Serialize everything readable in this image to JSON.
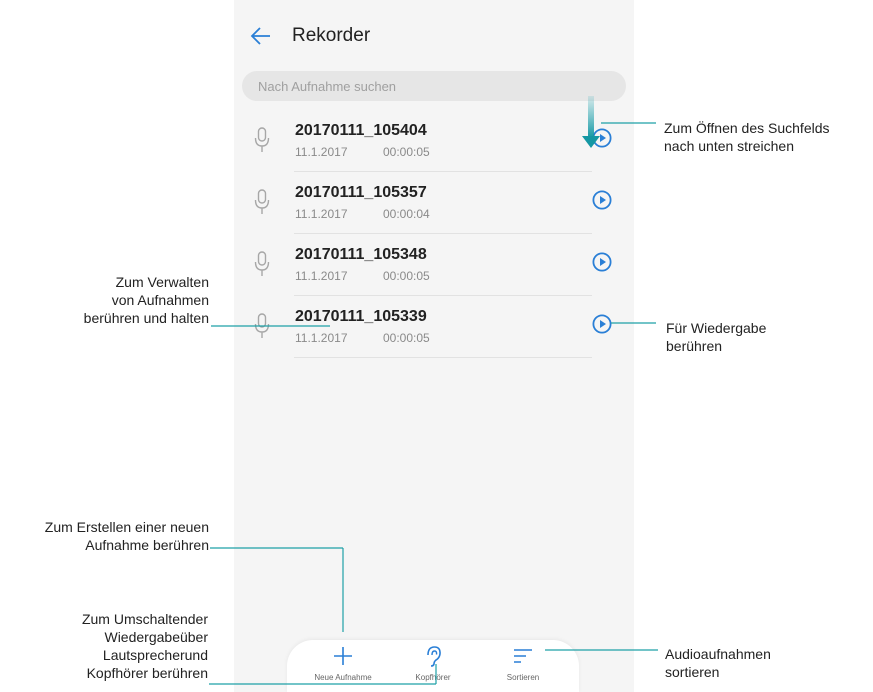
{
  "app": {
    "title": "Rekorder",
    "search_placeholder": "Nach Aufnahme suchen"
  },
  "recordings": [
    {
      "name": "20170111_105404",
      "date": "11.1.2017",
      "duration": "00:00:05"
    },
    {
      "name": "20170111_105357",
      "date": "11.1.2017",
      "duration": "00:00:04"
    },
    {
      "name": "20170111_105348",
      "date": "11.1.2017",
      "duration": "00:00:05"
    },
    {
      "name": "20170111_105339",
      "date": "11.1.2017",
      "duration": "00:00:05"
    }
  ],
  "toolbar": {
    "new_label": "Neue Aufnahme",
    "headphone_label": "Kopfhörer",
    "sort_label": "Sortieren"
  },
  "callouts": {
    "swipe": [
      "Zum Öffnen des Suchfelds",
      "nach unten streichen"
    ],
    "manage": [
      "Zum Verwalten",
      "von Aufnahmen",
      "berühren und halten"
    ],
    "play": [
      "Für Wiedergabe",
      "berühren"
    ],
    "create": [
      "Zum Erstellen einer neuen",
      "Aufnahme berühren"
    ],
    "switch": [
      "Zum Umschaltender",
      "Wiedergabeüber",
      "Lautsprecherund",
      "Kopfhörer berühren"
    ],
    "sort": [
      "Audioaufnahmen",
      "sortieren"
    ]
  },
  "colors": {
    "accent": "#2a7fd6",
    "callout_line": "#1fa0a6",
    "mic": "#a7a7a7"
  },
  "icons": {
    "back": "arrow-left-icon",
    "mic": "microphone-icon",
    "play": "play-circle-icon",
    "add": "plus-icon",
    "headphone": "ear-icon",
    "sort": "sort-lines-icon",
    "swipe": "arrow-down-icon"
  }
}
